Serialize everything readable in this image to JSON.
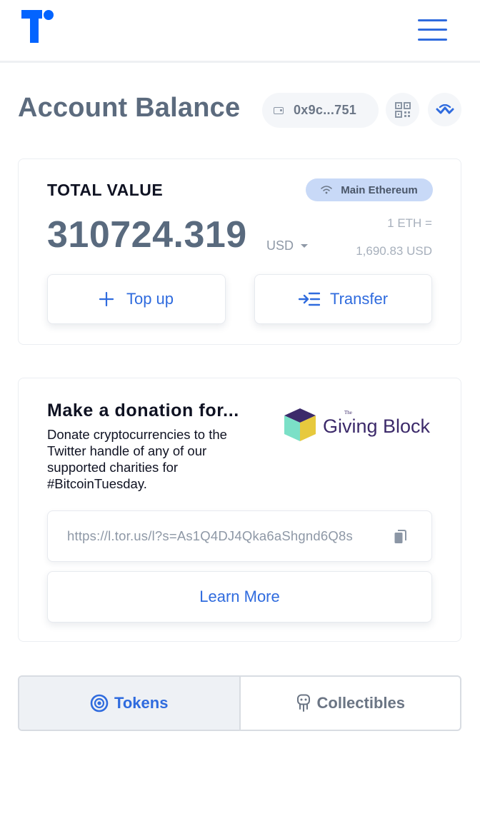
{
  "header": {
    "logo_icon": "torus-logo",
    "menu_icon": "hamburger-menu-icon"
  },
  "page": {
    "title": "Account Balance",
    "address": "0x9c...751",
    "qr_icon": "qr-code-icon",
    "wallet_connect_icon": "walletconnect-icon"
  },
  "total_value": {
    "label": "TOTAL VALUE",
    "network": "Main Ethereum",
    "balance": "310724.319",
    "currency": "USD",
    "rate_line1": "1 ETH =",
    "rate_line2": "1,690.83 USD",
    "topup_label": "Top up",
    "transfer_label": "Transfer"
  },
  "donation": {
    "title": "Make a donation for...",
    "description": "Donate cryptocurrencies to the Twitter handle of any of our supported charities for #BitcoinTuesday.",
    "partner_logo_text": "Giving Block",
    "partner_logo_small": "The",
    "link": "https://l.tor.us/l?s=As1Q4DJ4Qka6aShgnd6Q8s",
    "learn_more_label": "Learn More"
  },
  "tabs": [
    {
      "label": "Tokens",
      "icon": "tokens-icon",
      "active": true
    },
    {
      "label": "Collectibles",
      "icon": "collectibles-icon",
      "active": false
    }
  ],
  "colors": {
    "accent": "#2f6bde",
    "title": "#5c6b7e",
    "badge": "#c8d9f7"
  }
}
